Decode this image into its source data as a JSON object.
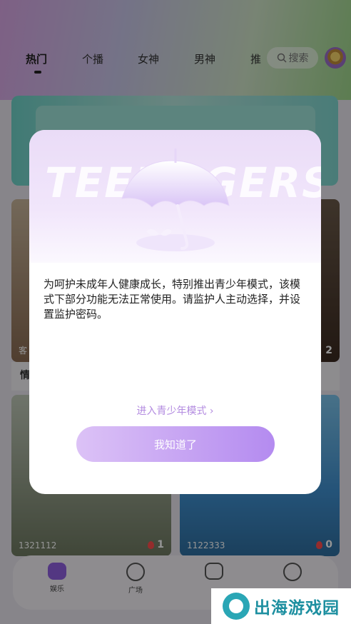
{
  "tabs": [
    "热门",
    "个播",
    "女神",
    "男神",
    "推"
  ],
  "search": {
    "label": "搜索"
  },
  "cards": [
    {
      "caption": "情",
      "tag": "客",
      "count": "2"
    },
    {
      "id": "1321112",
      "count": "1"
    },
    {
      "id": "1122333",
      "count": "0"
    }
  ],
  "bottom_nav": [
    "娱乐",
    "广场"
  ],
  "dialog": {
    "hero_text": "TEENAGERS",
    "message": "为呵护未成年人健康成长，特别推出青少年模式，该模式下部分功能无法正常使用。请监护人主动选择，并设置监护密码。",
    "enter_link": "进入青少年模式 ›",
    "ok_button": "我知道了"
  },
  "watermark": {
    "text": "出海游戏园"
  },
  "colors": {
    "accent": "#b48bf0",
    "link": "#b38be0"
  }
}
